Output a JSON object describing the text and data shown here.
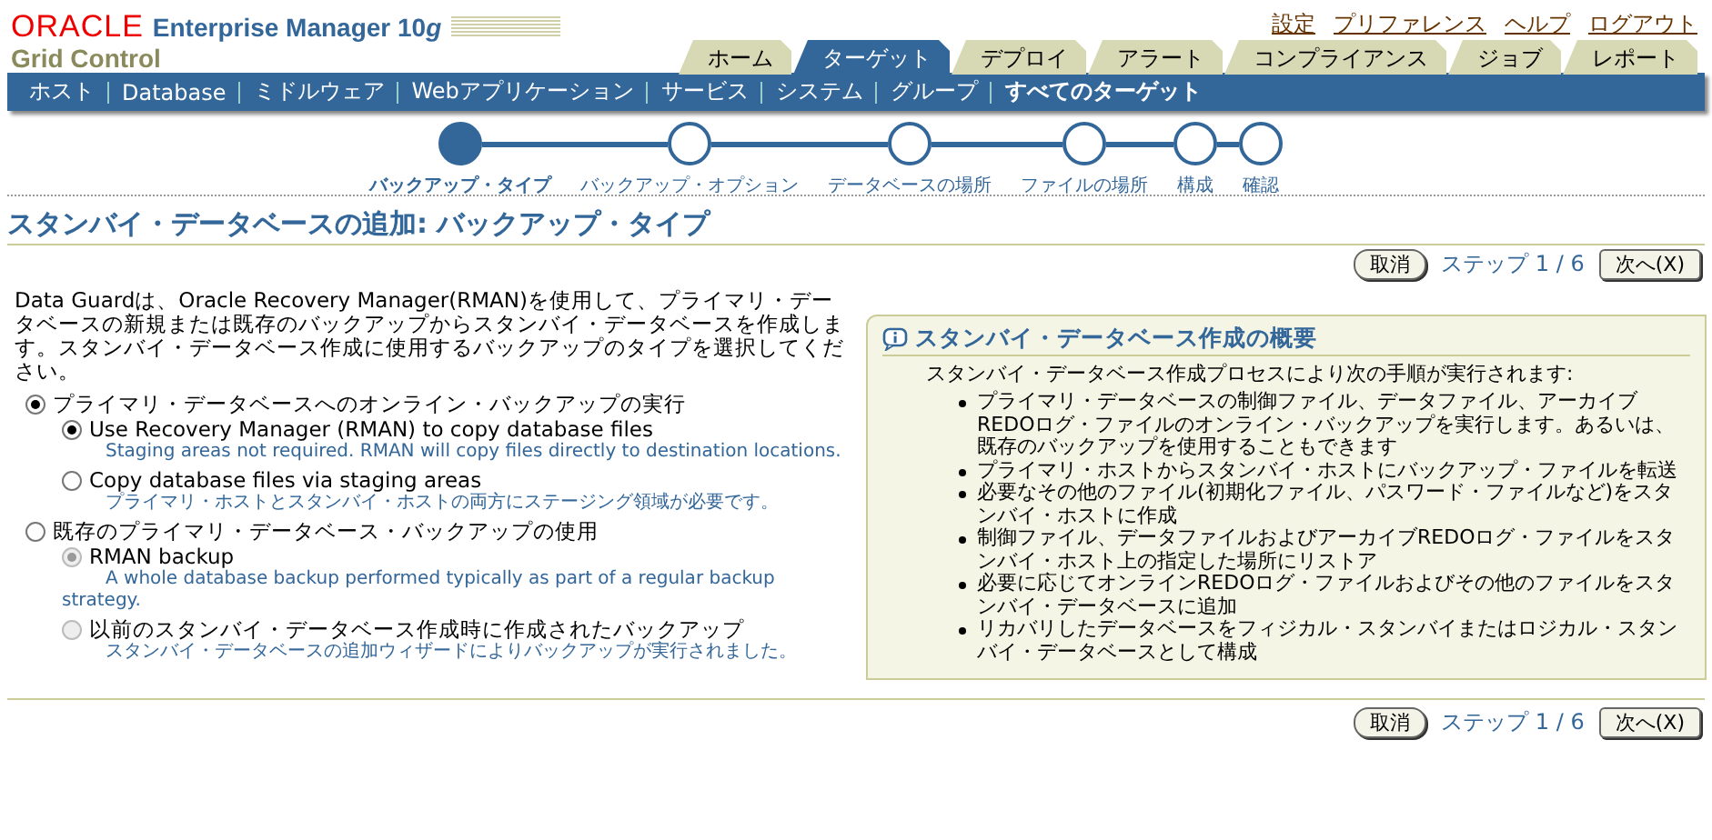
{
  "brand": {
    "vendor": "ORACLE",
    "product": "Enterprise Manager 10",
    "version_suffix": "g",
    "subtitle": "Grid Control"
  },
  "global_links": [
    "設定",
    "プリファレンス",
    "ヘルプ",
    "ログアウト"
  ],
  "tabs": [
    {
      "label": "ホーム",
      "selected": false
    },
    {
      "label": "ターゲット",
      "selected": true
    },
    {
      "label": "デプロイ",
      "selected": false
    },
    {
      "label": "アラート",
      "selected": false
    },
    {
      "label": "コンプライアンス",
      "selected": false
    },
    {
      "label": "ジョブ",
      "selected": false
    },
    {
      "label": "レポート",
      "selected": false
    }
  ],
  "subtabs": [
    {
      "label": "ホスト",
      "selected": false
    },
    {
      "label": "Database",
      "selected": false
    },
    {
      "label": "ミドルウェア",
      "selected": false
    },
    {
      "label": "Webアプリケーション",
      "selected": false
    },
    {
      "label": "サービス",
      "selected": false
    },
    {
      "label": "システム",
      "selected": false
    },
    {
      "label": "グループ",
      "selected": false
    },
    {
      "label": "すべてのターゲット",
      "selected": true
    }
  ],
  "train": [
    {
      "label": "バックアップ・タイプ",
      "selected": true
    },
    {
      "label": "バックアップ・オプション",
      "selected": false
    },
    {
      "label": "データベースの場所",
      "selected": false
    },
    {
      "label": "ファイルの場所",
      "selected": false
    },
    {
      "label": "構成",
      "selected": false
    },
    {
      "label": "確認",
      "selected": false
    }
  ],
  "page_title": "スタンバイ・データベースの追加: バックアップ・タイプ",
  "nav_top": {
    "cancel": "取消",
    "step": "ステップ 1 / 6",
    "next": "次へ(X)"
  },
  "intro": "Data Guardは、Oracle Recovery Manager(RMAN)を使用して、プライマリ・データベースの新規または既存のバックアップからスタンバイ・データベースを作成します。スタンバイ・データベース作成に使用するバックアップのタイプを選択してください。",
  "options": [
    {
      "label": "プライマリ・データベースへのオンライン・バックアップの実行",
      "selected": true,
      "disabled": false,
      "children": [
        {
          "label": "Use Recovery Manager (RMAN) to copy database files",
          "hint": "Staging areas not required. RMAN will copy files directly to destination locations.",
          "selected": true,
          "disabled": false
        },
        {
          "label": "Copy database files via staging areas",
          "hint": "プライマリ・ホストとスタンバイ・ホストの両方にステージング領域が必要です。",
          "selected": false,
          "disabled": false
        }
      ]
    },
    {
      "label": "既存のプライマリ・データベース・バックアップの使用",
      "selected": false,
      "disabled": false,
      "children": [
        {
          "label": "RMAN backup",
          "hint": "A whole database backup performed typically as part of a regular backup strategy.",
          "selected": true,
          "disabled": true
        },
        {
          "label": "以前のスタンバイ・データベース作成時に作成されたバックアップ",
          "hint": "スタンバイ・データベースの追加ウィザードによりバックアップが実行されました。",
          "selected": false,
          "disabled": true
        }
      ]
    }
  ],
  "info_box": {
    "title": "スタンバイ・データベース作成の概要",
    "lead": "スタンバイ・データベース作成プロセスにより次の手順が実行されます:",
    "items": [
      "プライマリ・データベースの制御ファイル、データファイル、アーカイブREDOログ・ファイルのオンライン・バックアップを実行します。あるいは、既存のバックアップを使用することもできます",
      "プライマリ・ホストからスタンバイ・ホストにバックアップ・ファイルを転送",
      "必要なその他のファイル(初期化ファイル、パスワード・ファイルなど)をスタンバイ・ホストに作成",
      "制御ファイル、データファイルおよびアーカイブREDOログ・ファイルをスタンバイ・ホスト上の指定した場所にリストア",
      "必要に応じてオンラインREDOログ・ファイルおよびその他のファイルをスタンバイ・データベースに追加",
      "リカバリしたデータベースをフィジカル・スタンバイまたはロジカル・スタンバイ・データベースとして構成"
    ]
  },
  "nav_bottom": {
    "cancel": "取消",
    "step": "ステップ 1 / 6",
    "next": "次へ(X)"
  }
}
